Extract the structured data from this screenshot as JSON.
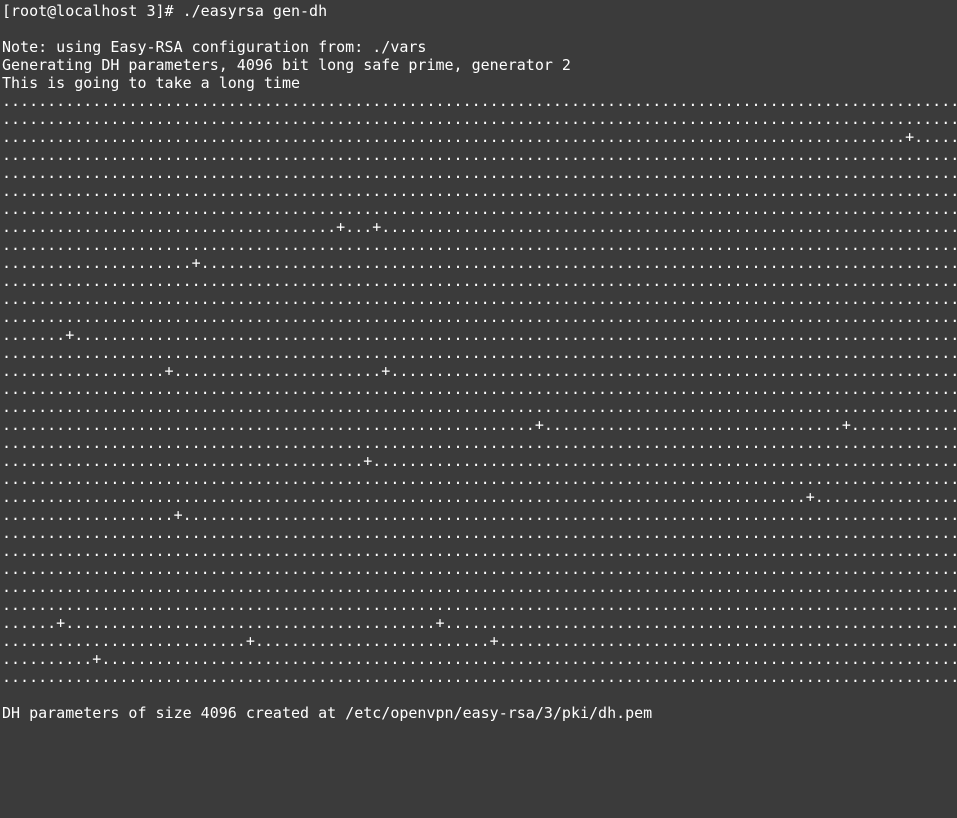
{
  "terminal": {
    "prompt": "[root@localhost 3]#",
    "command": "./easyrsa gen-dh",
    "output": [
      "Note: using Easy-RSA configuration from: ./vars",
      "Generating DH parameters, 4096 bit long safe prime, generator 2",
      "This is going to take a long time"
    ],
    "progress_lines": [
      "...........................................................................................................................................",
      "...........................................................................................................................................",
      "....................................................................................................+......................................",
      "...........................................................................................................................................",
      "...........................................................................................................................................",
      "...........................................................................................................................................",
      "...........................................................................................................................................",
      ".....................................+...+.................................................................................................",
      "...........................................................................................................................................",
      ".....................+.....................................................................................................................",
      "...........................................................................................................................................",
      "...........................................................................................................................................",
      "............................................................................................................................................",
      ".......+...................................................................................................................................",
      "...........................................................................................................................................+",
      "..................+.......................+................................................................................................",
      "..........................................................................................................+................................",
      "...................................................................................................................+.......................",
      "...........................................................+.................................+.............................................",
      "......................................................................................................................................+....",
      "........................................+..................................................................................................",
      "...........................................................................................................................................",
      ".........................................................................................+.................................................",
      "...................+.......................................................................................................................",
      "...........................................................................................................................................",
      ".......................................................................................................................................+...",
      "...........................................................................................................................................",
      "...........................................................................................................................................",
      "...........................................................................................................................................",
      "......+.........................................+..........................................................................................",
      "...........................+..........................+....................................................................................",
      "..........+................................................................................................................................",
      "...................................................................................................................+....++*++*"
    ],
    "result_prefix": "DH parameters of size 4096 created at ",
    "result_path": "/etc/openvpn/easy-rsa/3/pki/dh.pem"
  },
  "colors": {
    "background": "#3b3b3b",
    "text": "#ffffff",
    "highlight_underline": "#e0142b"
  }
}
